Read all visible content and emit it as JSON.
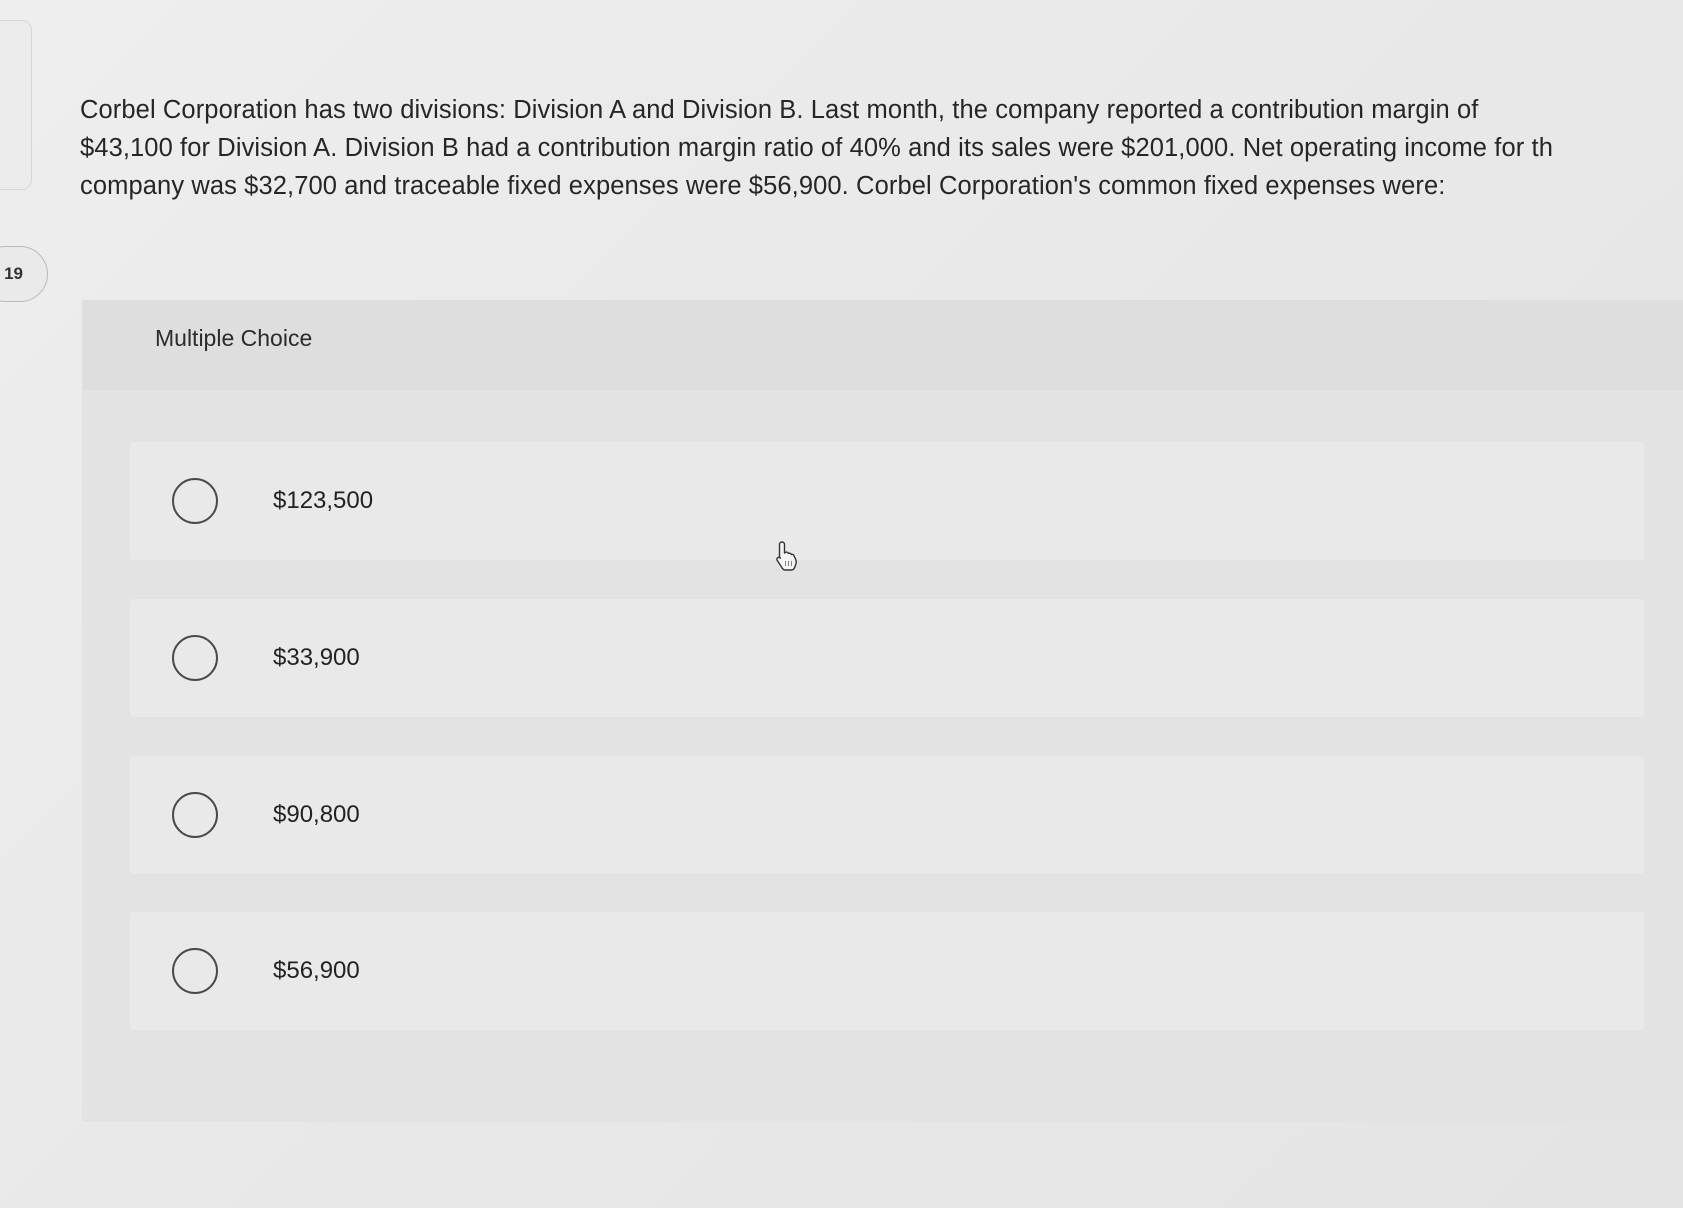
{
  "question": {
    "number": "19",
    "lines": [
      "Corbel Corporation has two divisions: Division A and Division B. Last month, the company reported a contribution margin of",
      "$43,100 for Division A. Division B had a contribution margin ratio of 40% and its sales were $201,000. Net operating income for th",
      "company was $32,700 and traceable fixed expenses were $56,900. Corbel Corporation's common fixed expenses were:"
    ]
  },
  "multiple_choice": {
    "label": "Multiple Choice",
    "options": [
      {
        "label": "$123,500"
      },
      {
        "label": "$33,900"
      },
      {
        "label": "$90,800"
      },
      {
        "label": "$56,900"
      }
    ]
  },
  "icons": {
    "cursor": "hand-pointer-icon",
    "option_radio": "radio-unselected-icon"
  }
}
